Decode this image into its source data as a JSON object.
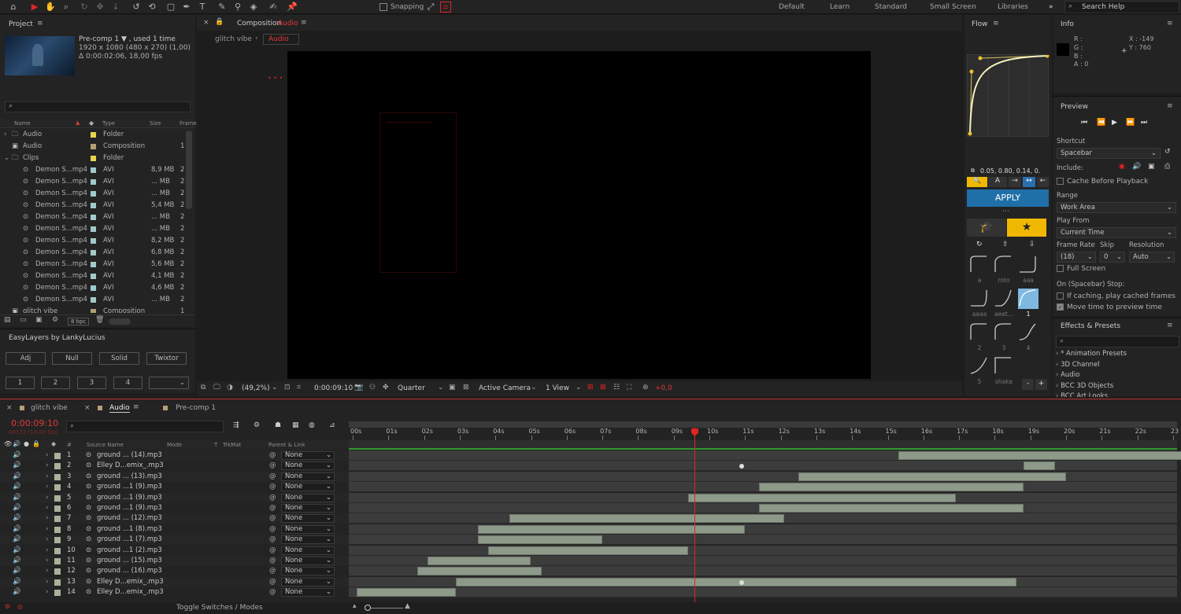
{
  "toolbar": {
    "snapping_label": "Snapping",
    "workspaces": [
      "Default",
      "Learn",
      "Standard",
      "Small Screen",
      "Libraries"
    ],
    "search_placeholder": "Search Help"
  },
  "project": {
    "title": "Project",
    "item_name": "Pre-comp 1 ▼ , used 1 time",
    "item_size": "1920 x 1080  (480 x 270) (1,00)",
    "item_duration": "Δ 0:00:02:06, 18,00 fps",
    "columns": {
      "name": "Name",
      "type": "Type",
      "size": "Size",
      "frame": "Frame"
    },
    "items": [
      {
        "name": "Audio",
        "type": "Folder",
        "size": "",
        "fr": "",
        "color": "#e8d44d",
        "kind": "folder",
        "indent": 0
      },
      {
        "name": "Audio",
        "type": "Composition",
        "size": "",
        "fr": "1",
        "color": "#b59d76",
        "kind": "comp",
        "indent": 0
      },
      {
        "name": "Clips",
        "type": "Folder",
        "size": "",
        "fr": "",
        "color": "#e8d44d",
        "kind": "folder",
        "indent": 0
      },
      {
        "name": "Demon S...mp4",
        "type": "AVI",
        "size": "8,9 MB",
        "fr": "2",
        "color": "#a3c9c9",
        "kind": "file",
        "indent": 1
      },
      {
        "name": "Demon S...mp4",
        "type": "AVI",
        "size": "... MB",
        "fr": "2",
        "color": "#a3c9c9",
        "kind": "file",
        "indent": 1
      },
      {
        "name": "Demon S...mp4",
        "type": "AVI",
        "size": "... MB",
        "fr": "2",
        "color": "#a3c9c9",
        "kind": "file",
        "indent": 1
      },
      {
        "name": "Demon S...mp4",
        "type": "AVI",
        "size": "5,4 MB",
        "fr": "2",
        "color": "#a3c9c9",
        "kind": "file",
        "indent": 1
      },
      {
        "name": "Demon S...mp4",
        "type": "AVI",
        "size": "... MB",
        "fr": "2",
        "color": "#a3c9c9",
        "kind": "file",
        "indent": 1
      },
      {
        "name": "Demon S...mp4",
        "type": "AVI",
        "size": "... MB",
        "fr": "2",
        "color": "#a3c9c9",
        "kind": "file",
        "indent": 1
      },
      {
        "name": "Demon S...mp4",
        "type": "AVI",
        "size": "8,2 MB",
        "fr": "2",
        "color": "#a3c9c9",
        "kind": "file",
        "indent": 1
      },
      {
        "name": "Demon S...mp4",
        "type": "AVI",
        "size": "6,8 MB",
        "fr": "2",
        "color": "#a3c9c9",
        "kind": "file",
        "indent": 1
      },
      {
        "name": "Demon S...mp4",
        "type": "AVI",
        "size": "5,6 MB",
        "fr": "2",
        "color": "#a3c9c9",
        "kind": "file",
        "indent": 1
      },
      {
        "name": "Demon S...mp4",
        "type": "AVI",
        "size": "4,1 MB",
        "fr": "2",
        "color": "#a3c9c9",
        "kind": "file",
        "indent": 1
      },
      {
        "name": "Demon S...mp4",
        "type": "AVI",
        "size": "4,6 MB",
        "fr": "2",
        "color": "#a3c9c9",
        "kind": "file",
        "indent": 1
      },
      {
        "name": "Demon S...mp4",
        "type": "AVI",
        "size": "... MB",
        "fr": "2",
        "color": "#a3c9c9",
        "kind": "file",
        "indent": 1
      },
      {
        "name": "glitch vibe",
        "type": "Composition",
        "size": "",
        "fr": "1",
        "color": "#b59d76",
        "kind": "comp",
        "indent": 0
      }
    ],
    "bpc": "8 bpc"
  },
  "easylayers": {
    "title": "EasyLayers by LankyLucius",
    "buttons": [
      "Adj",
      "Null",
      "Solid",
      "Twixtor"
    ],
    "numbers": [
      "1",
      "2",
      "3",
      "4"
    ]
  },
  "composition": {
    "tab_prefix": "Composition",
    "tab_name": "Audio",
    "breadcrumb_parent": "glitch vibe",
    "breadcrumb_current": "Audio",
    "zoom": "(49,2%)",
    "timecode": "0:00:09:10",
    "resolution": "Quarter",
    "camera": "Active Camera",
    "views": "1 View",
    "exposure": "+0,0"
  },
  "flow": {
    "title": "Flow",
    "values": "0.05, 0.80, 0.14, 0.",
    "apply_label": "APPLY",
    "presets": [
      {
        "label": "a"
      },
      {
        "label": "roto"
      },
      {
        "label": "aaa"
      },
      {
        "label": "aaaa"
      },
      {
        "label": "aeet..."
      },
      {
        "label": "1"
      },
      {
        "label": "2"
      },
      {
        "label": "3"
      },
      {
        "label": "4"
      },
      {
        "label": "5"
      },
      {
        "label": "shake"
      }
    ],
    "minus": "-",
    "plus": "+"
  },
  "info": {
    "title": "Info",
    "r": "R :",
    "g": "G :",
    "b": "B :",
    "a": "A : 0",
    "x": "X : -149",
    "y": "Y : 760"
  },
  "preview": {
    "title": "Preview",
    "shortcut_label": "Shortcut",
    "shortcut_value": "Spacebar",
    "include_label": "Include:",
    "cache_label": "Cache Before Playback",
    "range_label": "Range",
    "range_value": "Work Area",
    "playfrom_label": "Play From",
    "playfrom_value": "Current Time",
    "framerate_label": "Frame Rate",
    "skip_label": "Skip",
    "resolution_label": "Resolution",
    "framerate_value": "(18)",
    "skip_value": "0",
    "resolution_value": "Auto",
    "fullscreen_label": "Full Screen",
    "stop_label": "On (Spacebar) Stop:",
    "ifcaching_label": "If caching, play cached frames",
    "movetime_label": "Move time to preview time"
  },
  "effects": {
    "title": "Effects & Presets",
    "items": [
      "* Animation Presets",
      "3D Channel",
      "Audio",
      "BCC 3D Objects",
      "BCC Art Looks"
    ]
  },
  "timeline": {
    "tabs": [
      {
        "label": "glitch vibe",
        "color": "#b59d76"
      },
      {
        "label": "Audio",
        "color": "#b59d76"
      },
      {
        "label": "Pre-comp 1",
        "color": "#b59d76"
      }
    ],
    "timecode": "0:00:09:10",
    "frame_info": "00172 (18.00 fps)",
    "columns": {
      "source": "Source Name",
      "mode": "Mode",
      "t": "T",
      "trkmat": "TrkMat",
      "parent": "Parent & Link"
    },
    "ruler": [
      "00s",
      "01s",
      "02s",
      "03s",
      "04s",
      "05s",
      "06s",
      "07s",
      "08s",
      "09s",
      "10s",
      "11s",
      "12s",
      "13s",
      "14s",
      "15s",
      "16s",
      "17s",
      "18s",
      "19s",
      "20s",
      "21s",
      "22s",
      "23"
    ],
    "playhead_seconds": 9.58,
    "layers": [
      {
        "num": "1",
        "name": "ground ... (14).mp3",
        "parent": "None",
        "start": 15.3,
        "end": 24.0,
        "keyframe": null
      },
      {
        "num": "2",
        "name": "Elley D...emix_.mp3",
        "parent": "None",
        "start": 18.8,
        "end": 19.7,
        "keyframe": 10.9
      },
      {
        "num": "3",
        "name": "ground ... (13).mp3",
        "parent": "None",
        "start": 12.5,
        "end": 20.0,
        "keyframe": null
      },
      {
        "num": "4",
        "name": "ground ...1 (9).mp3",
        "parent": "None",
        "start": 11.4,
        "end": 18.8,
        "keyframe": null
      },
      {
        "num": "5",
        "name": "ground ...1 (9).mp3",
        "parent": "None",
        "start": 9.4,
        "end": 16.9,
        "keyframe": null
      },
      {
        "num": "6",
        "name": "ground ...1 (9).mp3",
        "parent": "None",
        "start": 11.4,
        "end": 18.8,
        "keyframe": null
      },
      {
        "num": "7",
        "name": "ground ... (12).mp3",
        "parent": "None",
        "start": 4.4,
        "end": 12.1,
        "keyframe": null
      },
      {
        "num": "8",
        "name": "ground ...1 (8).mp3",
        "parent": "None",
        "start": 3.5,
        "end": 11.0,
        "keyframe": null
      },
      {
        "num": "9",
        "name": "ground ...1 (7).mp3",
        "parent": "None",
        "start": 3.5,
        "end": 7.0,
        "keyframe": null
      },
      {
        "num": "10",
        "name": "ground ...1 (2).mp3",
        "parent": "None",
        "start": 3.8,
        "end": 9.4,
        "keyframe": null
      },
      {
        "num": "11",
        "name": "ground ... (15).mp3",
        "parent": "None",
        "start": 2.1,
        "end": 5.0,
        "keyframe": null
      },
      {
        "num": "12",
        "name": "ground ... (16).mp3",
        "parent": "None",
        "start": 1.8,
        "end": 5.3,
        "keyframe": null
      },
      {
        "num": "13",
        "name": "Elley D...emix_.mp3",
        "parent": "None",
        "start": 2.9,
        "end": 18.6,
        "keyframe": 10.9
      },
      {
        "num": "14",
        "name": "Elley D...emix_.mp3",
        "parent": "None",
        "start": 0.1,
        "end": 2.9,
        "keyframe": null
      }
    ],
    "toggle_label": "Toggle Switches / Modes"
  },
  "colors": {
    "accent": "#d42020",
    "flow_yellow": "#f0b800",
    "apply_blue": "#1f6fa8"
  }
}
